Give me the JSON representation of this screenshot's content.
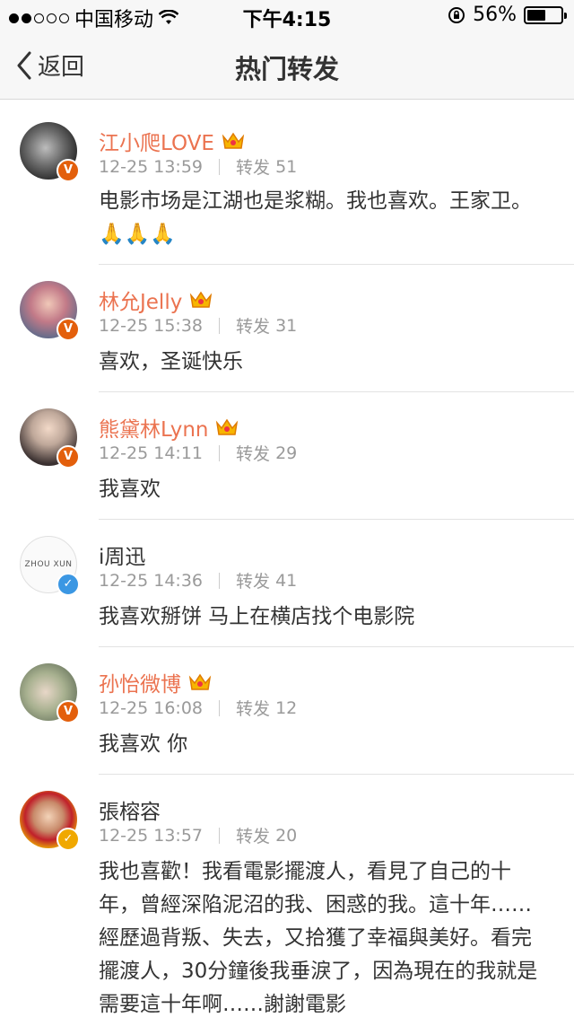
{
  "status_bar": {
    "carrier": "中国移动",
    "time": "下午4:15",
    "battery": "56%",
    "battery_level": 0.56
  },
  "nav": {
    "back_label": "返回",
    "title": "热门转发"
  },
  "repost_label": "转发",
  "items": [
    {
      "name": "江小爬LOVE",
      "vip": true,
      "verified": "red",
      "time": "12-25 13:59",
      "reposts": "51",
      "text": "电影市场是江湖也是浆糊。我也喜欢。王家卫。🙏🙏🙏"
    },
    {
      "name": "林允Jelly",
      "vip": true,
      "verified": "red",
      "time": "12-25 15:38",
      "reposts": "31",
      "text": "喜欢，圣诞快乐"
    },
    {
      "name": "熊黛林Lynn",
      "vip": true,
      "verified": "red",
      "time": "12-25 14:11",
      "reposts": "29",
      "text": "我喜欢"
    },
    {
      "name": "i周迅",
      "vip": false,
      "verified": "blue",
      "avatar_text": "ZHOU XUN",
      "time": "12-25 14:36",
      "reposts": "41",
      "text": "我喜欢掰饼 马上在横店找个电影院"
    },
    {
      "name": "孙怡微博",
      "vip": true,
      "verified": "red",
      "time": "12-25 16:08",
      "reposts": "12",
      "text": "我喜欢 你"
    },
    {
      "name": "張榕容",
      "vip": false,
      "verified": "yellow",
      "time": "12-25 13:57",
      "reposts": "20",
      "text": "我也喜歡！我看電影擺渡人，看見了自己的十年，曾經深陷泥沼的我、困惑的我。這十年……經歷過背叛、失去，又拾獲了幸福與美好。看完擺渡人，30分鐘後我垂淚了，因為現在的我就是需要這十年啊……謝謝電影"
    }
  ]
}
